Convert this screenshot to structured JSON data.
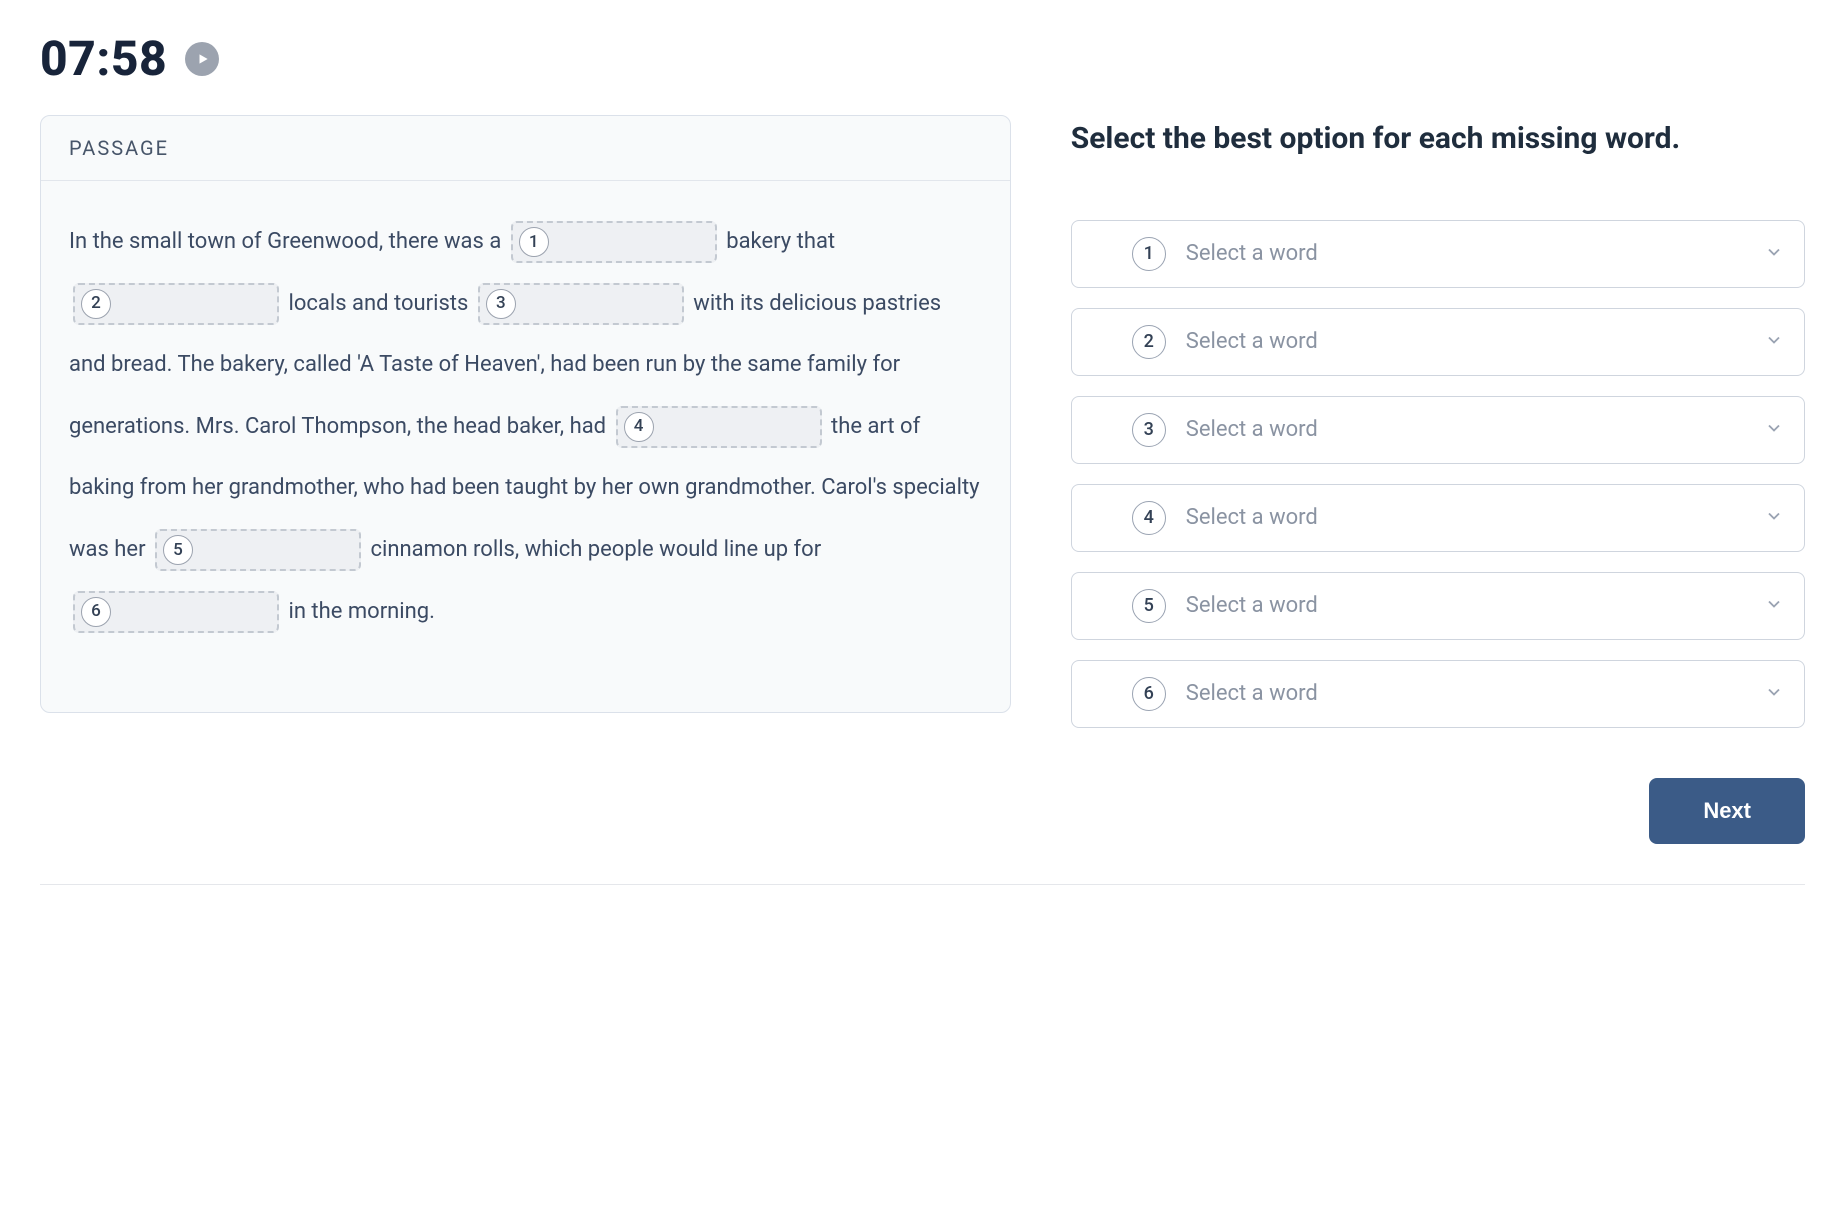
{
  "timer": "07:58",
  "passage": {
    "header": "PASSAGE",
    "segments": {
      "s0": "In the small town of Greenwood, there was a ",
      "s1": " bakery that ",
      "s2": " locals and tourists ",
      "s3": " with its delicious pastries and bread. The bakery, called 'A Taste of Heaven', had been run by the same family for generations. Mrs. Carol Thompson, the head baker, had ",
      "s4": " the art of baking from her grandmother, who had been taught by her own grandmother. Carol's specialty was her ",
      "s5": " cinnamon rolls, which people would line up for ",
      "s6": " in the morning."
    },
    "blanks": [
      "1",
      "2",
      "3",
      "4",
      "5",
      "6"
    ]
  },
  "instruction": "Select the best option for each missing word.",
  "selects": [
    {
      "num": "1",
      "placeholder": "Select a word"
    },
    {
      "num": "2",
      "placeholder": "Select a word"
    },
    {
      "num": "3",
      "placeholder": "Select a word"
    },
    {
      "num": "4",
      "placeholder": "Select a word"
    },
    {
      "num": "5",
      "placeholder": "Select a word"
    },
    {
      "num": "6",
      "placeholder": "Select a word"
    }
  ],
  "next_label": "Next"
}
